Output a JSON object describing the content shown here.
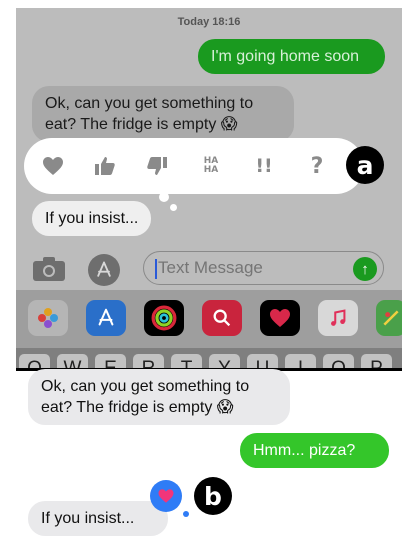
{
  "panel_a": {
    "timestamp": "Today 18:16",
    "messages": [
      {
        "text": "I'm going home soon"
      },
      {
        "text": "Ok, can you get something to eat? The fridge is empty 😱"
      }
    ],
    "reactions": {
      "haha_top": "HA",
      "haha_bottom": "HA",
      "exclaim": "!!",
      "question": "?"
    },
    "reply": "If you insist...",
    "composer": {
      "placeholder": "Text Message",
      "send_glyph": "↑"
    },
    "app_icons": [
      "photos-app",
      "app-store-app",
      "activity-app",
      "search-images-app",
      "digital-touch-app",
      "music-app",
      "maps-app"
    ],
    "keys": [
      "Q",
      "W",
      "E",
      "R",
      "T",
      "Y",
      "U",
      "I",
      "O",
      "P"
    ],
    "badge": "a"
  },
  "panel_b": {
    "messages": [
      {
        "text": "Ok, can you get something to eat? The fridge is empty 😱"
      },
      {
        "text": "Hmm... pizza?"
      },
      {
        "text": "If you insist..."
      }
    ],
    "badge": "b"
  },
  "colors": {
    "imessage_blue": "#2f7cf6",
    "sms_green": "#34c62a",
    "heart_pink": "#f2357a"
  }
}
